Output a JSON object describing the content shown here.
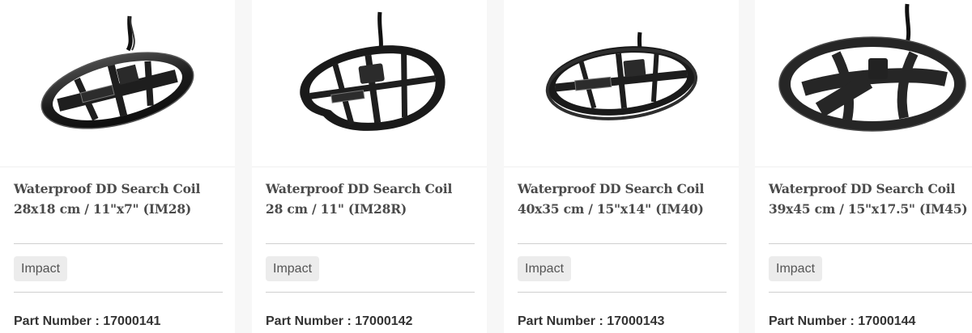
{
  "products": [
    {
      "title_line1": "Waterproof DD Search Coil",
      "title_line2": "28x18 cm / 11\"x7\" (IM28)",
      "brand": "Impact",
      "part_number": "Part Number : 17000141",
      "image_icon": "search-coil-elliptical"
    },
    {
      "title_line1": "Waterproof DD Search Coil",
      "title_line2": "28 cm / 11\" (IM28R)",
      "brand": "Impact",
      "part_number": "Part Number : 17000142",
      "image_icon": "search-coil-round"
    },
    {
      "title_line1": "Waterproof DD Search Coil",
      "title_line2": "40x35 cm / 15\"x14\" (IM40)",
      "brand": "Impact",
      "part_number": "Part Number : 17000143",
      "image_icon": "search-coil-elliptical"
    },
    {
      "title_line1": "Waterproof DD Search Coil",
      "title_line2": "39x45 cm / 15\"x17.5\" (IM45)",
      "brand": "Impact",
      "part_number": "Part Number : 17000144",
      "image_icon": "search-coil-solid"
    }
  ],
  "colors": {
    "page_background": "#f7f7f7",
    "card_background": "#ffffff",
    "title_text": "#4a4a4a",
    "tag_background": "#ececec",
    "coil_body": "#1b1b1b"
  }
}
